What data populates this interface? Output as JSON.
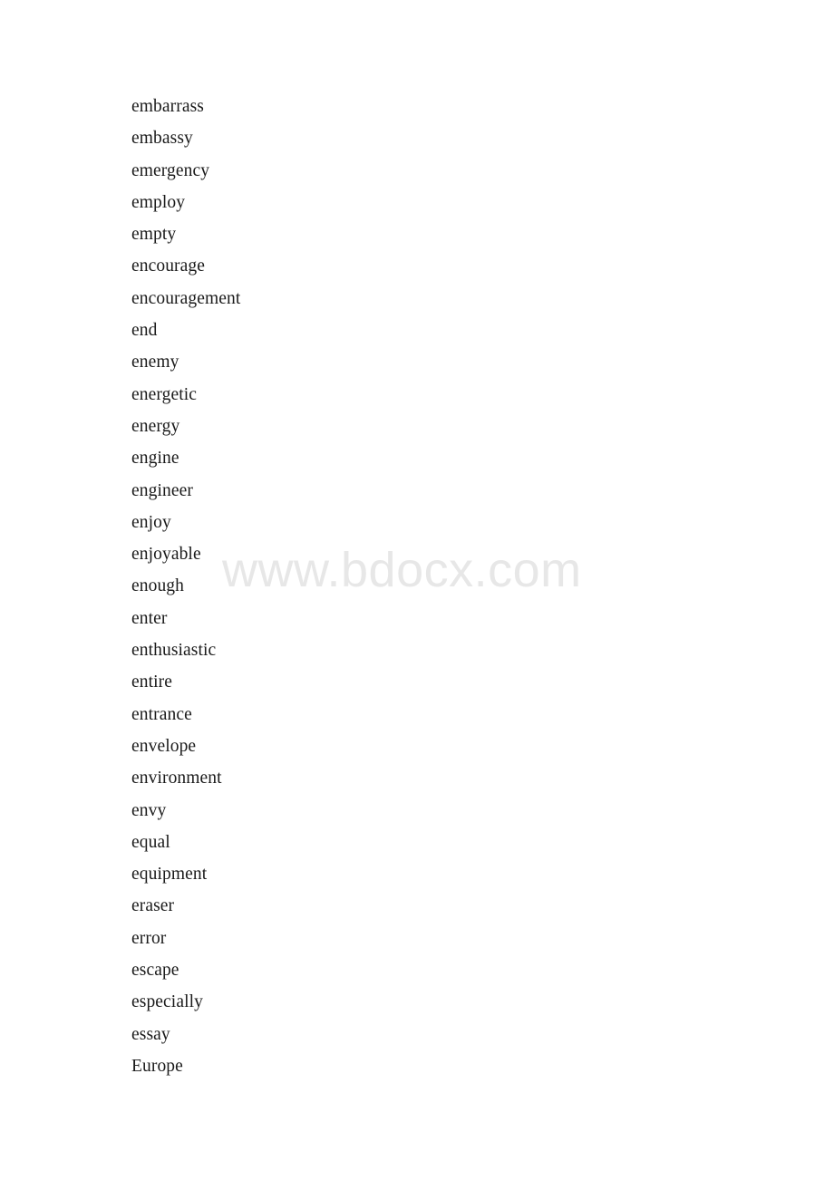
{
  "document": {
    "background_color": "#ffffff",
    "text_color": "#1a1a1a"
  },
  "watermark": {
    "text": "www.bdocx.com",
    "color": "#e7e7e7"
  },
  "word_list": {
    "words": [
      "embarrass",
      "embassy",
      "emergency",
      "employ",
      "empty",
      "encourage",
      "encouragement",
      "end",
      "enemy",
      "energetic",
      "energy",
      "engine",
      "engineer",
      "enjoy",
      "enjoyable",
      "enough",
      "enter",
      "enthusiastic",
      "entire",
      "entrance",
      "envelope",
      "environment",
      "envy",
      "equal",
      "equipment",
      "eraser",
      "error",
      "escape",
      "especially",
      "essay",
      "Europe"
    ]
  }
}
